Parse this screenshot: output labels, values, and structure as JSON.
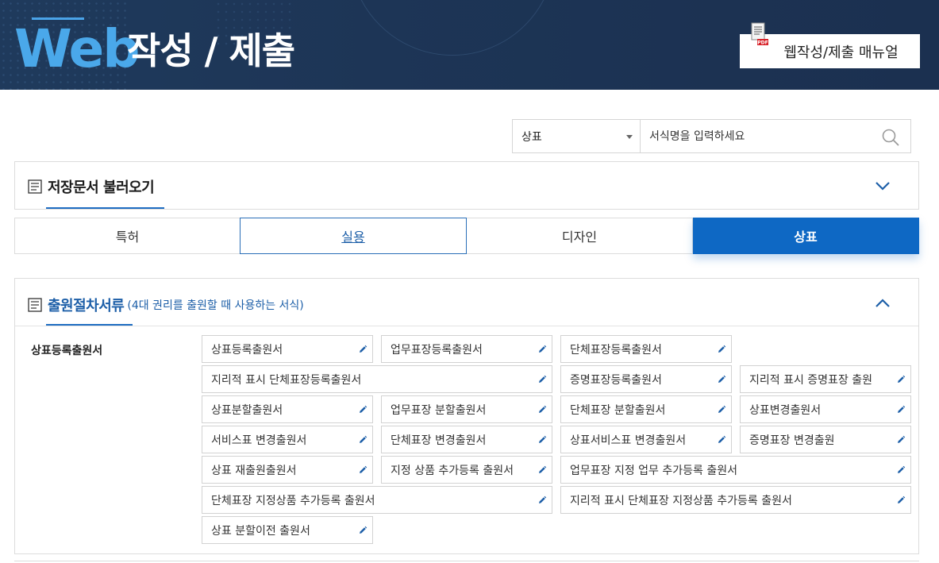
{
  "header": {
    "title_web": "Web",
    "title_rest": "작성 / 제출",
    "manual_label": "웹작성/제출 매뉴얼",
    "pdf_badge": "PDF"
  },
  "search": {
    "select_value": "상표",
    "placeholder": "서식명을 입력하세요"
  },
  "saved_panel": {
    "title": "저장문서 불러오기"
  },
  "tabs": [
    {
      "label": "특허",
      "state": "normal"
    },
    {
      "label": "실용",
      "state": "hover"
    },
    {
      "label": "디자인",
      "state": "normal"
    },
    {
      "label": "상표",
      "state": "active"
    }
  ],
  "forms_panel": {
    "title": "출원절차서류",
    "subtitle": "(4대 권리를 출원할 때 사용하는 서식)",
    "category": "상표등록출원서",
    "items": [
      "상표등록출원서",
      "업무표장등록출원서",
      "단체표장등록출원서",
      "지리적 표시 단체표장등록출원서",
      "증명표장등록출원서",
      "지리적 표시 증명표장 출원",
      "상표분할출원서",
      "업무표장 분할출원서",
      "단체표장 분할출원서",
      "상표변경출원서",
      "서비스표 변경출원서",
      "단체표장 변경출원서",
      "상표서비스표 변경출원서",
      "증명표장 변경출원",
      "상표 재출원출원서",
      "지정 상품 추가등록 출원서",
      "업무표장 지정 업무 추가등록 출원서",
      "단체표장 지정상품 추가등록 출원서",
      "지리적 표시 단체표장 지정상품 추가등록 출원서",
      "상표 분할이전 출원서"
    ]
  },
  "colors": {
    "banner": "#1d3556",
    "web_accent": "#4aa8ea",
    "active_tab": "#0e68c4",
    "section_title": "#1d5fa8"
  }
}
